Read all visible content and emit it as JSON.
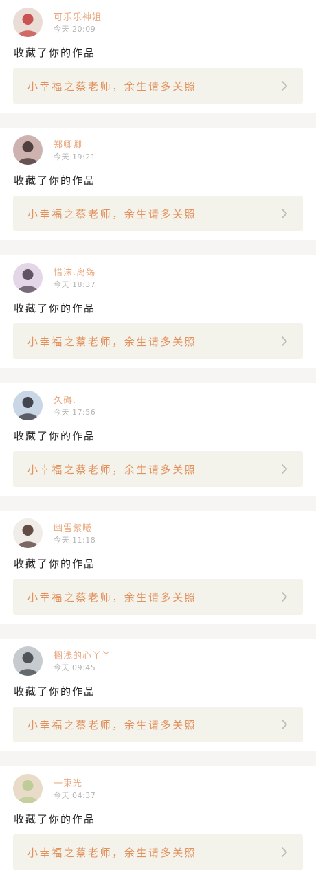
{
  "colors": {
    "name": "#e9a77f",
    "work_title": "#e3915c",
    "chevron": "#b9b9b9",
    "card_bg": "#ffffff",
    "work_bg": "#f3f3ec",
    "page_bg": "#f6f5f3"
  },
  "icons": {
    "chevron": "chevron-right-icon",
    "avatar": "avatar-image"
  },
  "notifications": [
    {
      "user": "可乐乐神姐",
      "time": "今天 20:09",
      "action": "收藏了你的作品",
      "work_title": "小幸福之蔡老师，余生请多关照",
      "avatar_colors": [
        "#e9ddd6",
        "#c23b3b"
      ]
    },
    {
      "user": "郑卿卿",
      "time": "今天 19:21",
      "action": "收藏了你的作品",
      "work_title": "小幸福之蔡老师，余生请多关照",
      "avatar_colors": [
        "#ceb2b0",
        "#3a2a2c"
      ]
    },
    {
      "user": "惜沫.离殇",
      "time": "今天 18:37",
      "action": "收藏了你的作品",
      "work_title": "小幸福之蔡老师，余生请多关照",
      "avatar_colors": [
        "#e3d6e6",
        "#4b3c4a"
      ]
    },
    {
      "user": "久碍.",
      "time": "今天 17:56",
      "action": "收藏了你的作品",
      "work_title": "小幸福之蔡老师，余生请多关照",
      "avatar_colors": [
        "#c9d6e6",
        "#2b2b33"
      ]
    },
    {
      "user": "幽雪紫曦",
      "time": "今天 11:18",
      "action": "收藏了你的作品",
      "work_title": "小幸福之蔡老师，余生请多关照",
      "avatar_colors": [
        "#f0ece8",
        "#4a3029"
      ]
    },
    {
      "user": "搁浅的心丫丫",
      "time": "今天 09:45",
      "action": "收藏了你的作品",
      "work_title": "小幸福之蔡老师，余生请多关照",
      "avatar_colors": [
        "#c6cbcf",
        "#3b3f45"
      ]
    },
    {
      "user": "一束光",
      "time": "今天 04:37",
      "action": "收藏了你的作品",
      "work_title": "小幸福之蔡老师，余生请多关照",
      "avatar_colors": [
        "#e8dcc8",
        "#b7c98f"
      ]
    }
  ]
}
